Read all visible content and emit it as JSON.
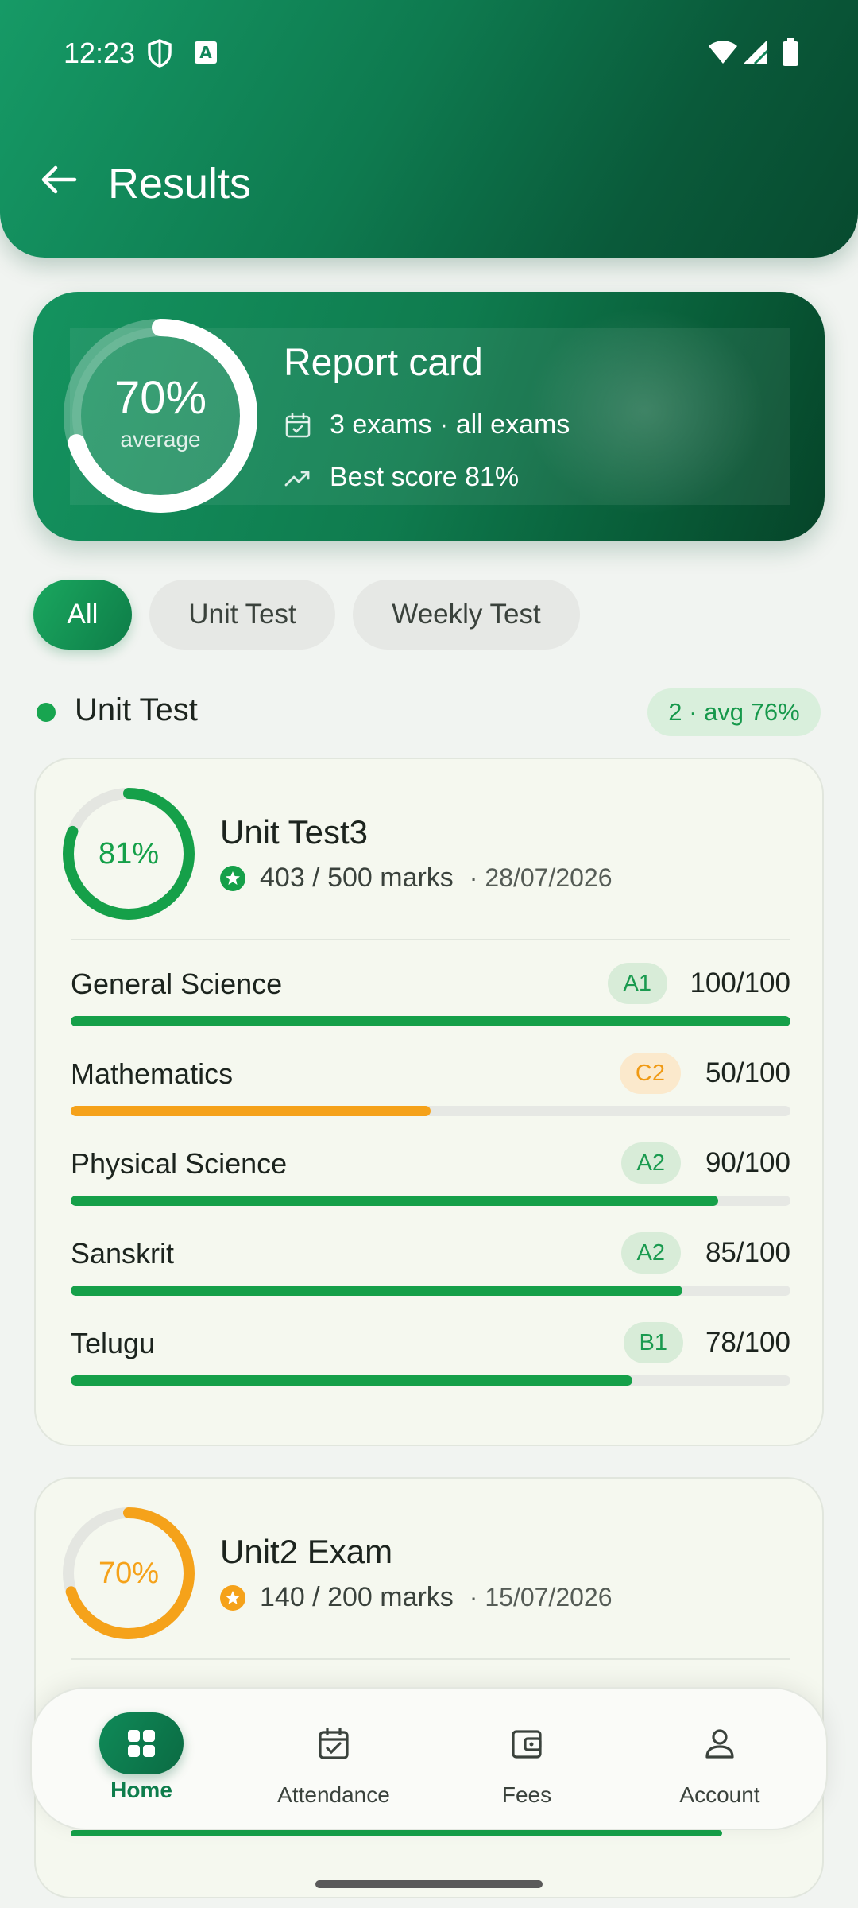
{
  "status_bar": {
    "time": "12:23"
  },
  "header": {
    "title": "Results"
  },
  "report_card": {
    "title": "Report card",
    "average_pct": "70%",
    "average_value": 0.7,
    "average_label": "average",
    "exams_line": "3 exams · all exams",
    "best_line": "Best score 81%"
  },
  "filters": [
    {
      "label": "All",
      "active": true
    },
    {
      "label": "Unit Test",
      "active": false
    },
    {
      "label": "Weekly Test",
      "active": false
    }
  ],
  "section": {
    "title": "Unit Test",
    "badge": "2 · avg 76%"
  },
  "exams": [
    {
      "title": "Unit Test3",
      "pct": "81%",
      "pct_value": 0.81,
      "color": "#15a049",
      "marks": "403 / 500 marks",
      "date": "· 28/07/2026",
      "subjects": [
        {
          "name": "General Science",
          "grade": "A1",
          "score": "100/100",
          "fraction": 1.0,
          "tone": "green"
        },
        {
          "name": "Mathematics",
          "grade": "C2",
          "score": "50/100",
          "fraction": 0.5,
          "tone": "orange"
        },
        {
          "name": "Physical Science",
          "grade": "A2",
          "score": "90/100",
          "fraction": 0.9,
          "tone": "green"
        },
        {
          "name": "Sanskrit",
          "grade": "A2",
          "score": "85/100",
          "fraction": 0.85,
          "tone": "green"
        },
        {
          "name": "Telugu",
          "grade": "B1",
          "score": "78/100",
          "fraction": 0.78,
          "tone": "green"
        }
      ]
    },
    {
      "title": "Unit2 Exam",
      "pct": "70%",
      "pct_value": 0.7,
      "color": "#f5a21a",
      "marks": "140 / 200 marks",
      "date": "· 15/07/2026"
    }
  ],
  "bottom_nav": [
    {
      "label": "Home",
      "icon": "grid-icon",
      "active": true
    },
    {
      "label": "Attendance",
      "icon": "calendar-check-icon",
      "active": false
    },
    {
      "label": "Fees",
      "icon": "wallet-icon",
      "active": false
    },
    {
      "label": "Account",
      "icon": "person-icon",
      "active": false
    }
  ],
  "colors": {
    "brand": "#0f7b4e",
    "green": "#15a049",
    "orange": "#f5a21a"
  }
}
